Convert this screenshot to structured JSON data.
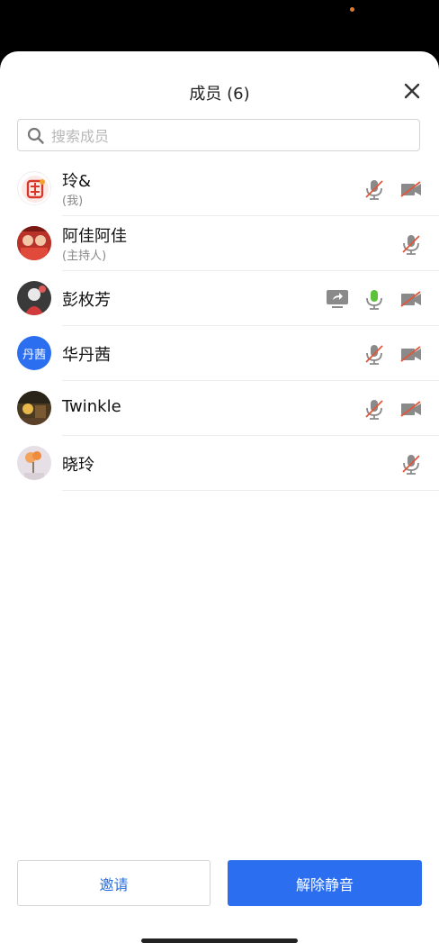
{
  "header": {
    "title": "成员 (6)"
  },
  "search": {
    "placeholder": "搜索成员"
  },
  "members": [
    {
      "name": "玲&",
      "role": "(我)"
    },
    {
      "name": "阿佳阿佳",
      "role": "(主持人)"
    },
    {
      "name": "彭枚芳",
      "role": ""
    },
    {
      "name": "华丹茜",
      "avatar_text": "丹茜"
    },
    {
      "name": "Twinkle"
    },
    {
      "name": "晓玲"
    }
  ],
  "actions": {
    "invite_label": "邀请",
    "unmute_label": "解除静音"
  },
  "colors": {
    "primary": "#2b6ff0",
    "mic_active": "#5cc23a",
    "muted_slash": "#e0573c",
    "icon_gray": "#8a8a8a"
  }
}
